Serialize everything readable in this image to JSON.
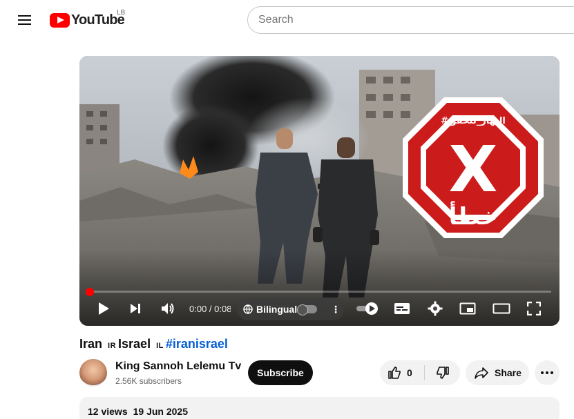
{
  "header": {
    "logo_text": "YouTube",
    "country_code": "LB",
    "search_placeholder": "Search"
  },
  "player": {
    "time": "0:00 / 0:08",
    "bilingual_label": "Bilingual",
    "overlay_hashtag": "#النهار_تتحقق",
    "overlay_mark": "X",
    "overlay_word": "خطأ",
    "progress_fraction": 0.0,
    "colors": {
      "progress": "#ff0000",
      "overlay_red": "#cc1b1b"
    }
  },
  "video": {
    "title_part1": "Iran",
    "flag1": "IR",
    "title_part2": "Israel",
    "flag2": "IL",
    "hashtag": "#iranisrael"
  },
  "channel": {
    "name": "King Sannoh Lelemu Tv",
    "subscribers": "2.56K subscribers",
    "subscribe_label": "Subscribe"
  },
  "actions": {
    "like_count": "0",
    "share_label": "Share"
  },
  "description": {
    "views": "12 views",
    "date": "19 Jun 2025"
  },
  "icons": [
    "menu-icon",
    "youtube-logo",
    "play-icon",
    "next-icon",
    "volume-icon",
    "globe-icon",
    "more-vert-icon",
    "autoplay-icon",
    "subtitles-icon",
    "settings-icon",
    "miniplayer-icon",
    "theater-icon",
    "fullscreen-icon",
    "thumbs-up-icon",
    "thumbs-down-icon",
    "share-icon",
    "more-horiz-icon"
  ]
}
